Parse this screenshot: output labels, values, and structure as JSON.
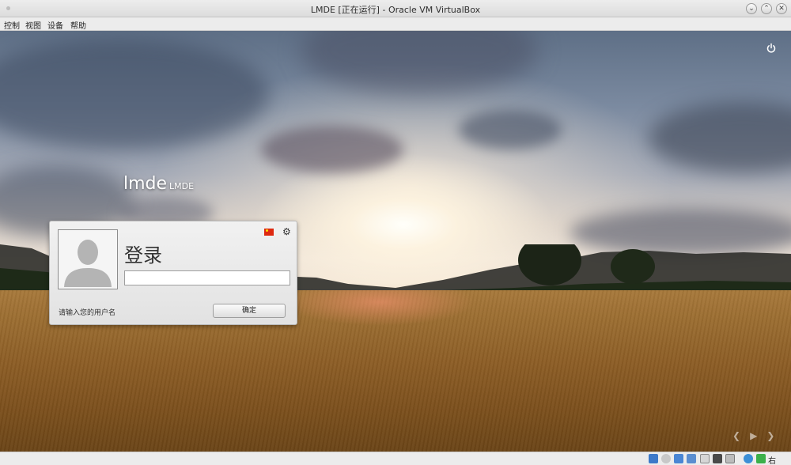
{
  "window": {
    "title": "LMDE [正在运行] - Oracle VM VirtualBox",
    "controls": [
      "minimize",
      "maximize",
      "close"
    ]
  },
  "menubar": {
    "items": [
      "控制",
      "视图",
      "设备",
      "帮助"
    ]
  },
  "login_screen": {
    "hostname": "lmde",
    "hostname_sub": "LMDE",
    "dialog": {
      "title": "登录",
      "username_value": "",
      "hint": "请输入您的用户名",
      "ok_label": "确定"
    },
    "icons": [
      "power-icon",
      "language-flag-icon",
      "gear-icon",
      "prev-arrow-icon",
      "play-arrow-icon",
      "next-arrow-icon"
    ]
  },
  "statusbar": {
    "host_key_label": "右 Ctrl",
    "icons": [
      "hard-disk-icon",
      "optical-drive-icon",
      "usb-icon",
      "network-icon",
      "shared-folders-icon",
      "display-icon",
      "video-capture-icon",
      "recording-icon",
      "cpu-icon",
      "mouse-integration-icon",
      "keyboard-icon"
    ]
  }
}
